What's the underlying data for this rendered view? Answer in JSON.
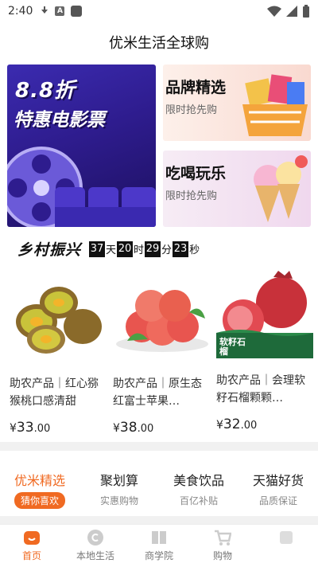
{
  "status_bar": {
    "time": "2:40"
  },
  "header": {
    "title": "优米生活全球购"
  },
  "banners": {
    "movie": {
      "line1": "8.8折",
      "line2": "特惠电影票"
    },
    "brand": {
      "title": "品牌精选",
      "subtitle": "限时抢先购"
    },
    "food": {
      "title": "吃喝玩乐",
      "subtitle": "限时抢先购"
    }
  },
  "rural": {
    "title": "乡村振兴",
    "countdown": {
      "days": "37",
      "day_unit": "天",
      "hours": "20",
      "hour_unit": "时",
      "minutes": "29",
      "minute_unit": "分",
      "seconds": "23",
      "second_unit": "秒"
    }
  },
  "products": [
    {
      "name": "助农产品｜红心猕猴桃口感清甜",
      "price_yen": "¥",
      "price_int": "33",
      "price_dec": ".00",
      "image_icon": "kiwi-image"
    },
    {
      "name": "助农产品｜原生态红富士苹果…",
      "price_yen": "¥",
      "price_int": "38",
      "price_dec": ".00",
      "image_icon": "apple-image"
    },
    {
      "name": "助农产品｜会理软籽石榴颗颗…",
      "price_yen": "¥",
      "price_int": "32",
      "price_dec": ".00",
      "image_icon": "pomegranate-image",
      "image_label": "软籽石榴"
    }
  ],
  "category_tabs": [
    {
      "title": "优米精选",
      "subtitle": "猜你喜欢",
      "active": true
    },
    {
      "title": "聚划算",
      "subtitle": "实惠购物",
      "active": false
    },
    {
      "title": "美食饮品",
      "subtitle": "百亿补贴",
      "active": false
    },
    {
      "title": "天猫好货",
      "subtitle": "品质保证",
      "active": false
    }
  ],
  "bottom_nav": [
    {
      "label": "首页",
      "icon": "home-icon",
      "active": true
    },
    {
      "label": "本地生活",
      "icon": "local-life-icon",
      "active": false
    },
    {
      "label": "商学院",
      "icon": "book-icon",
      "active": false
    },
    {
      "label": "购物",
      "icon": "cart-icon",
      "active": false
    },
    {
      "label": "",
      "icon": "profile-icon",
      "active": false
    }
  ],
  "colors": {
    "accent": "#f06a22",
    "movie_bg": "#2e1c8e"
  }
}
